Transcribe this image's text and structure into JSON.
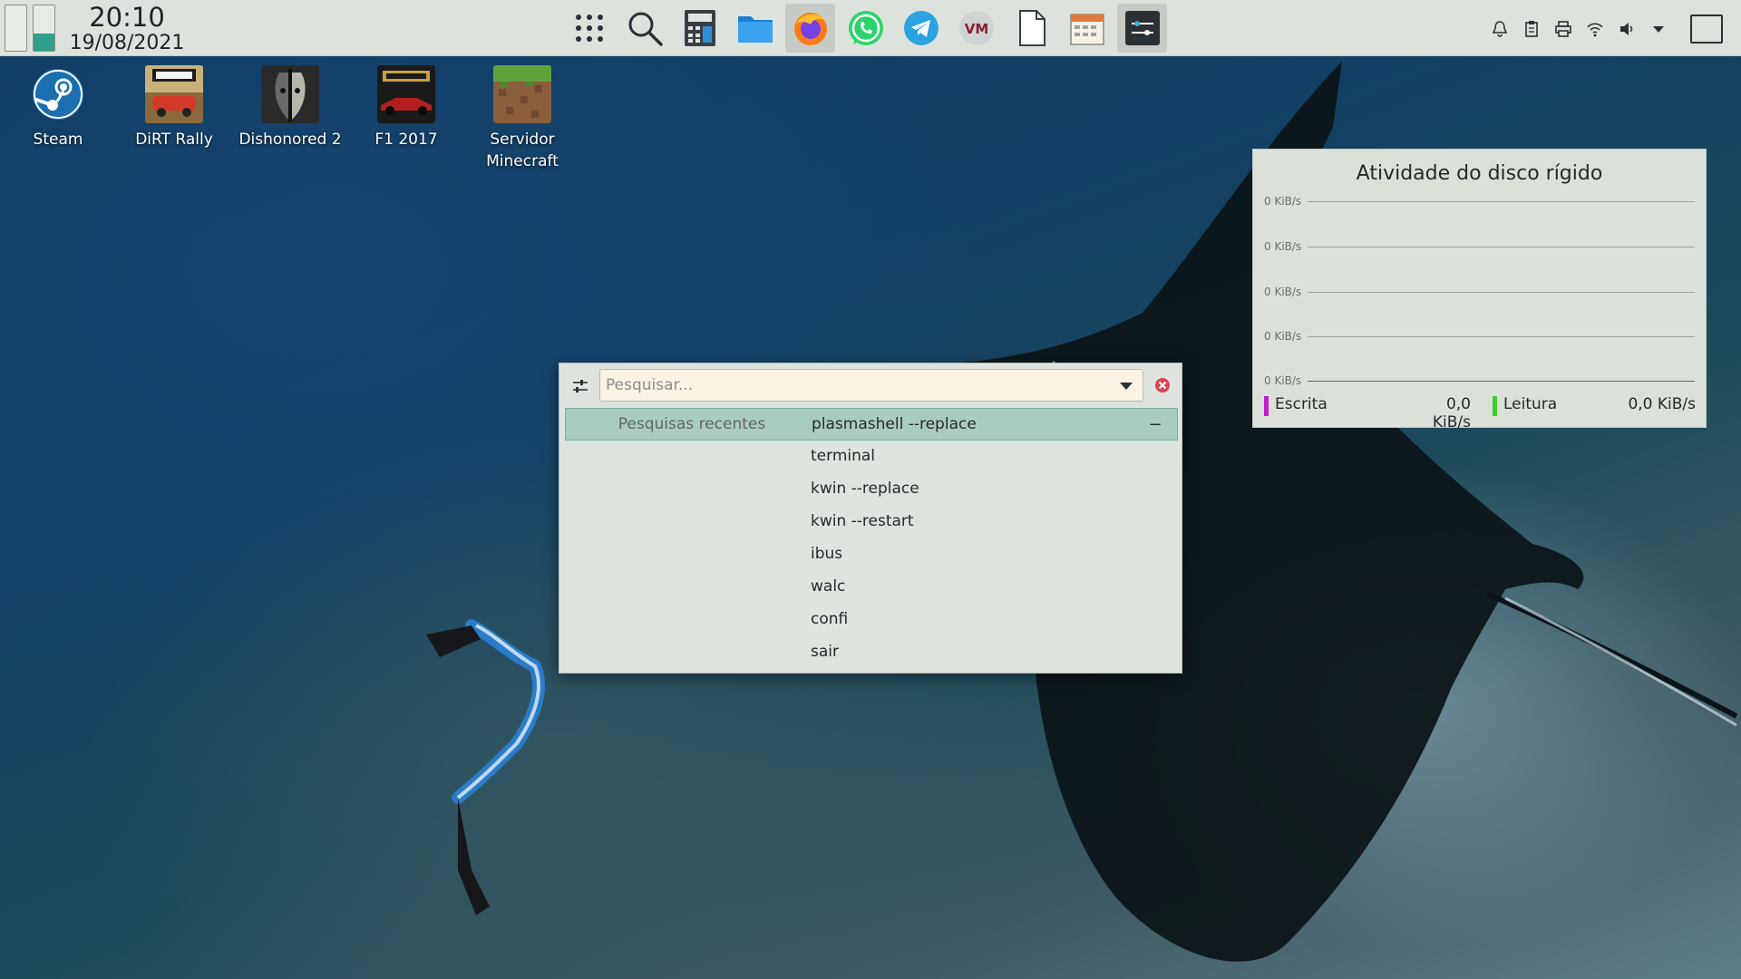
{
  "panel": {
    "clock": {
      "time": "20:10",
      "date": "19/08/2021"
    },
    "pager": [
      "desktop-1",
      "desktop-2"
    ],
    "tasks": [
      {
        "name": "app-launcher-icon"
      },
      {
        "name": "search-icon"
      },
      {
        "name": "calculator-icon"
      },
      {
        "name": "file-manager-icon"
      },
      {
        "name": "firefox-icon"
      },
      {
        "name": "whatsapp-icon"
      },
      {
        "name": "telegram-icon"
      },
      {
        "name": "vm-app-icon"
      },
      {
        "name": "blank-document-icon"
      },
      {
        "name": "calendar-notes-icon"
      },
      {
        "name": "system-settings-icon"
      }
    ],
    "tray": [
      "notifications-icon",
      "clipboard-icon",
      "printer-icon",
      "wifi-icon",
      "volume-icon",
      "expand-tray-icon"
    ]
  },
  "desktop": {
    "icons": [
      {
        "label": "Steam"
      },
      {
        "label": "DiRT Rally"
      },
      {
        "label": "Dishonored 2"
      },
      {
        "label": "F1 2017"
      },
      {
        "label": "Servidor Minecraft"
      }
    ]
  },
  "disk_widget": {
    "title": "Atividade do disco rígido",
    "y_labels": [
      "0 KiB/s",
      "0 KiB/s",
      "0 KiB/s",
      "0 KiB/s",
      "0 KiB/s"
    ],
    "write_label": "Escrita",
    "write_value": "0,0 KiB/s",
    "read_label": "Leitura",
    "read_value": "0,0 KiB/s",
    "write_color": "#c21ec9",
    "read_color": "#3ccf2e"
  },
  "krunner": {
    "placeholder": "Pesquisar...",
    "category": "Pesquisas recentes",
    "results": [
      "plasmashell --replace",
      "terminal",
      "kwin --replace",
      "kwin --restart",
      "ibus",
      "walc",
      "confi",
      "sair"
    ],
    "remove_glyph": "−"
  }
}
